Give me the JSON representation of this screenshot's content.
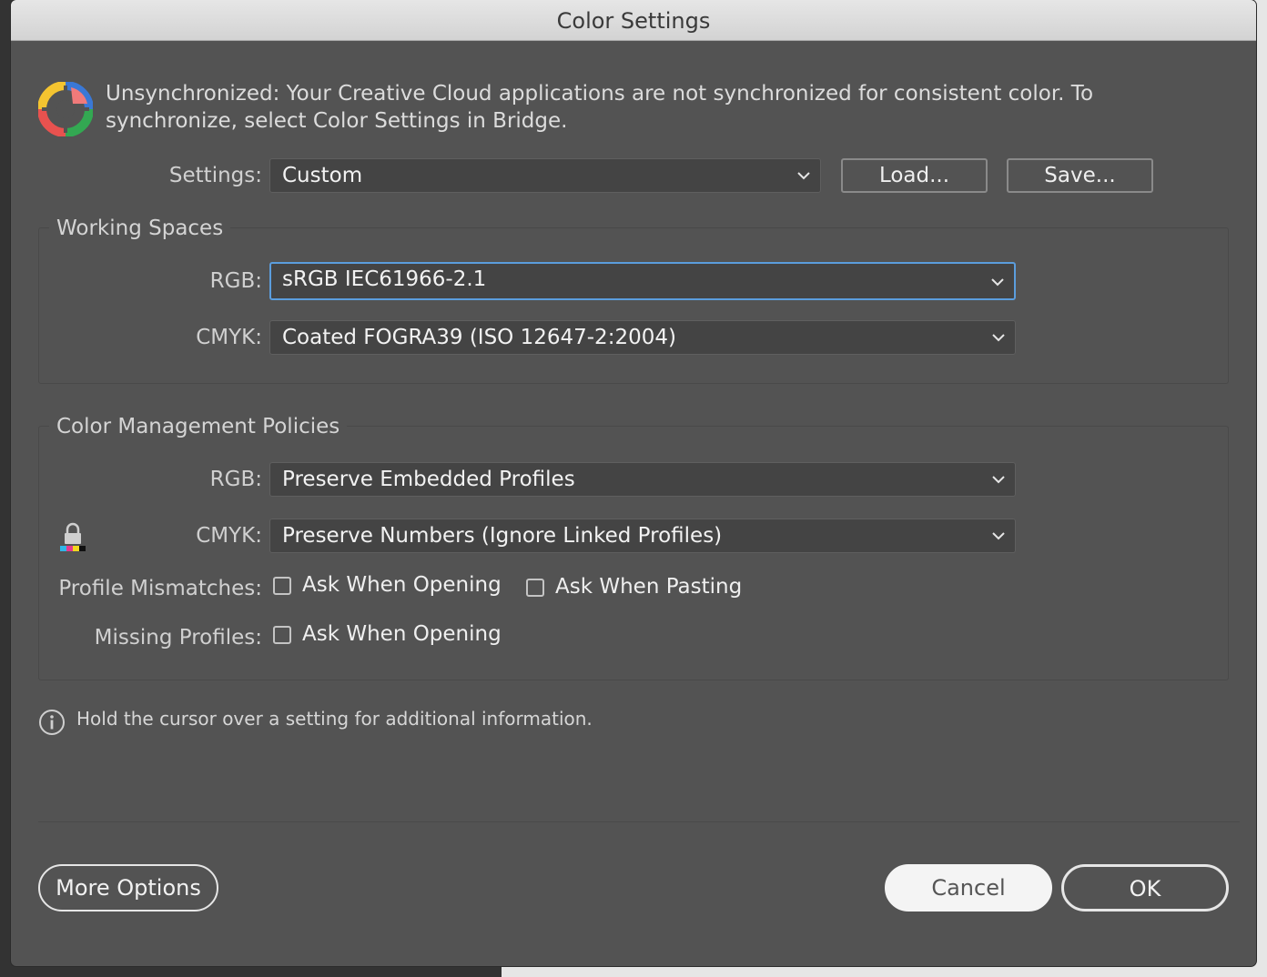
{
  "window": {
    "title": "Color Settings"
  },
  "header": {
    "message": "Unsynchronized: Your Creative Cloud applications are not synchronized for consistent color. To synchronize, select Color Settings in Bridge.",
    "icon": "creative-cloud-color-icon"
  },
  "settings": {
    "label": "Settings:",
    "value": "Custom",
    "load_label": "Load...",
    "save_label": "Save..."
  },
  "working_spaces": {
    "title": "Working Spaces",
    "rgb_label": "RGB:",
    "rgb_value": "sRGB IEC61966-2.1",
    "cmyk_label": "CMYK:",
    "cmyk_value": "Coated FOGRA39 (ISO 12647-2:2004)"
  },
  "policies": {
    "title": "Color Management Policies",
    "rgb_label": "RGB:",
    "rgb_value": "Preserve Embedded Profiles",
    "cmyk_label": "CMYK:",
    "cmyk_value": "Preserve Numbers (Ignore Linked Profiles)",
    "mismatch_label": "Profile Mismatches:",
    "mismatch_opening": "Ask When Opening",
    "mismatch_pasting": "Ask When Pasting",
    "missing_label": "Missing Profiles:",
    "missing_opening": "Ask When Opening",
    "checked": {
      "mismatch_opening": false,
      "mismatch_pasting": false,
      "missing_opening": false
    }
  },
  "info": {
    "text": "Hold the cursor over a setting for additional information."
  },
  "footer": {
    "more_options": "More Options",
    "cancel": "Cancel",
    "ok": "OK"
  },
  "colors": {
    "dialog_bg": "#535353",
    "focus_ring": "#5b9ddd",
    "field_bg": "#444444"
  }
}
